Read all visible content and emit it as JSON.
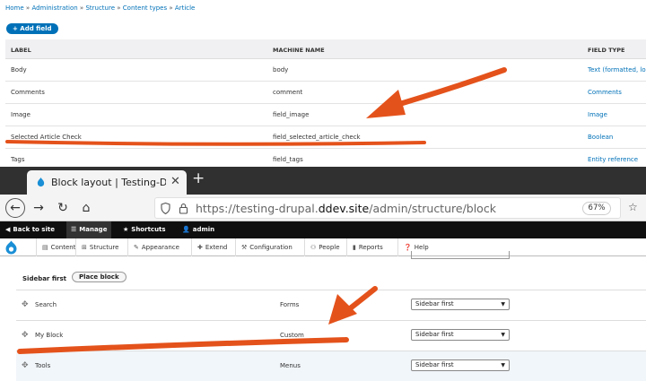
{
  "fields_page": {
    "breadcrumb": [
      "Home",
      "Administration",
      "Structure",
      "Content types",
      "Article"
    ],
    "breadcrumb_sep": "»",
    "add_field_label": "+ Add field",
    "columns": [
      "LABEL",
      "MACHINE NAME",
      "FIELD TYPE"
    ],
    "rows": [
      {
        "label": "Body",
        "machine": "body",
        "type": "Text (formatted, lon"
      },
      {
        "label": "Comments",
        "machine": "comment",
        "type": "Comments"
      },
      {
        "label": "Image",
        "machine": "field_image",
        "type": "Image"
      },
      {
        "label": "Selected Article Check",
        "machine": "field_selected_article_check",
        "type": "Boolean"
      },
      {
        "label": "Tags",
        "machine": "field_tags",
        "type": "Entity reference"
      }
    ]
  },
  "browser": {
    "tab_title": "Block layout | Testing-Drupal",
    "url_prefix": "https://testing-drupal.",
    "url_domain": "ddev.site",
    "url_path": "/admin/structure/block",
    "zoom": "67%"
  },
  "toolbar": {
    "back": "Back to site",
    "manage": "Manage",
    "shortcuts": "Shortcuts",
    "user": "admin"
  },
  "admin_menu": [
    "Content",
    "Structure",
    "Appearance",
    "Extend",
    "Configuration",
    "People",
    "Reports",
    "Help"
  ],
  "block_layout": {
    "region": "Sidebar first",
    "place_block": "Place block",
    "blocks": [
      {
        "name": "Search",
        "category": "Forms",
        "region": "Sidebar first"
      },
      {
        "name": "My Block",
        "category": "Custom",
        "region": "Sidebar first"
      },
      {
        "name": "Tools",
        "category": "Menus",
        "region": "Sidebar first"
      }
    ]
  },
  "colors": {
    "link": "#0071b8",
    "annotation": "#e4521b",
    "toolbar": "#0f0f0f"
  }
}
